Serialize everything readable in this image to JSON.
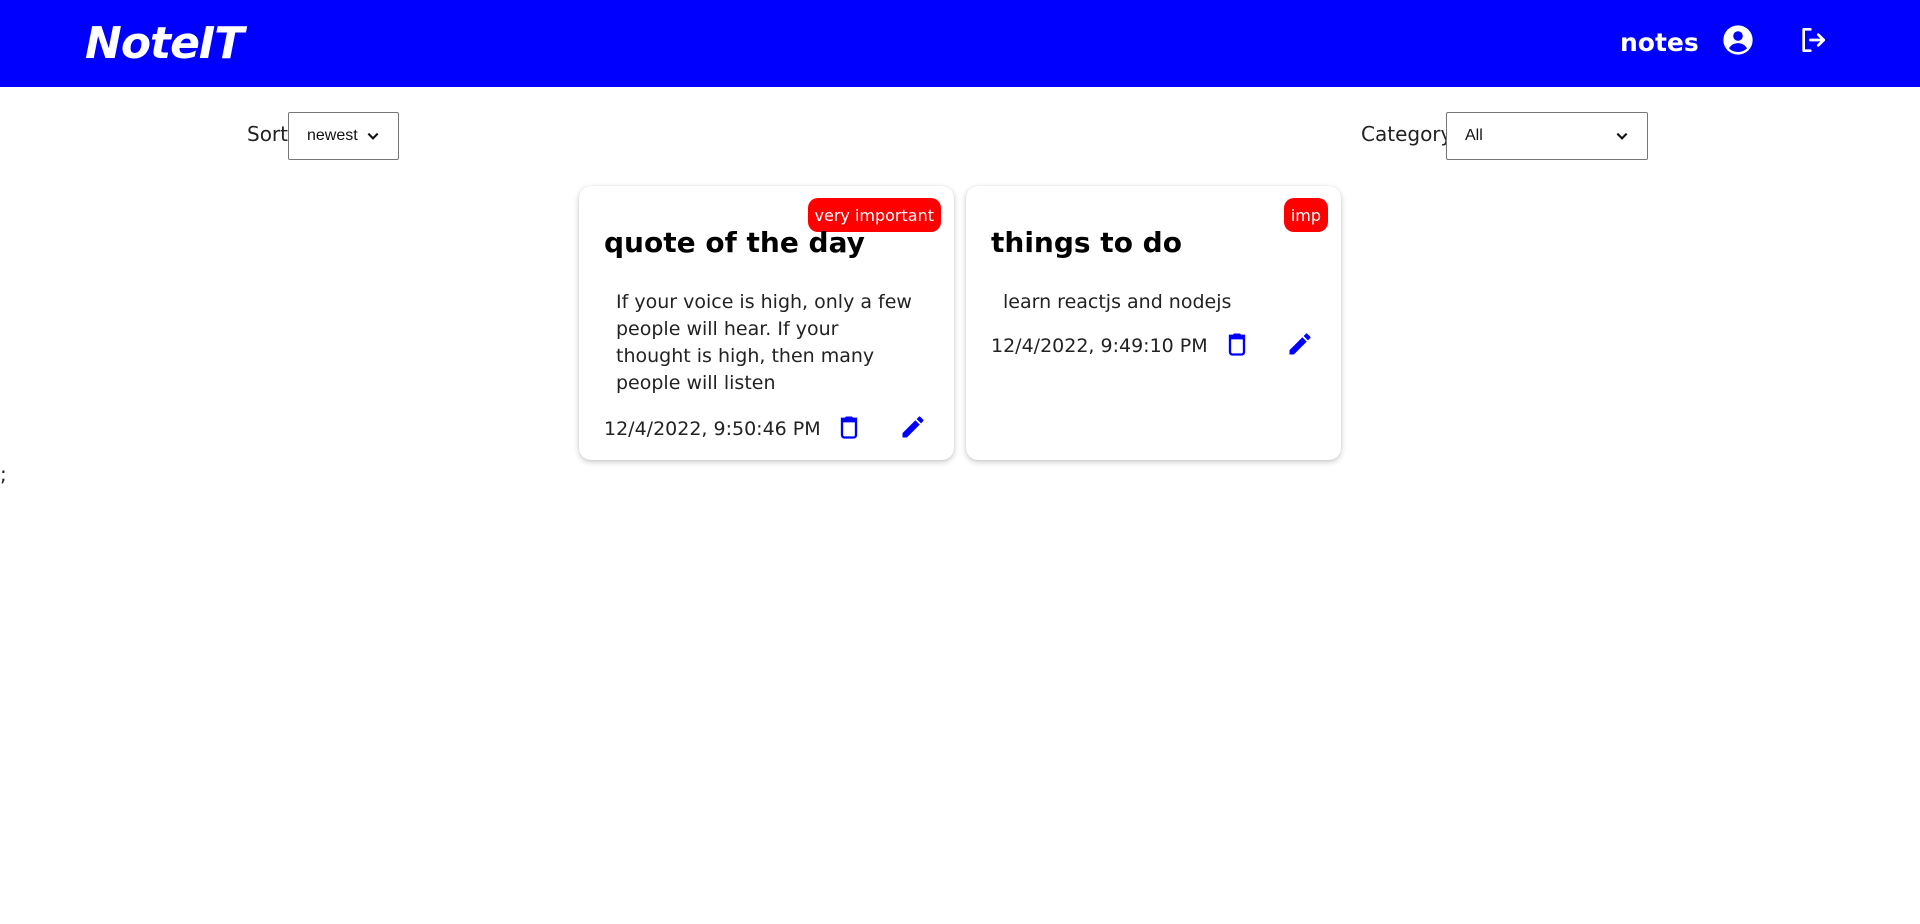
{
  "navbar": {
    "brand": "NoteIT",
    "link_notes": "notes",
    "icons": {
      "profile": "user-circle-icon",
      "logout": "logout-icon"
    },
    "color": "#0000ff"
  },
  "controls": {
    "sort_label": "Sort:",
    "sort_value": "newest",
    "category_label": "Category:",
    "category_value": "All"
  },
  "notes": [
    {
      "title": "quote of the day",
      "badge": "very important",
      "body": "If your voice is high, only a few people will hear. If your thought is high, then many people will listen",
      "date": "12/4/2022, 9:50:46 PM"
    },
    {
      "title": "things to do",
      "badge": "imp",
      "body": "learn reactjs and nodejs",
      "date": "12/4/2022, 9:49:10 PM"
    }
  ],
  "stray_text": ";",
  "colors": {
    "accent": "#0000ff",
    "badge": "#ff0000"
  }
}
